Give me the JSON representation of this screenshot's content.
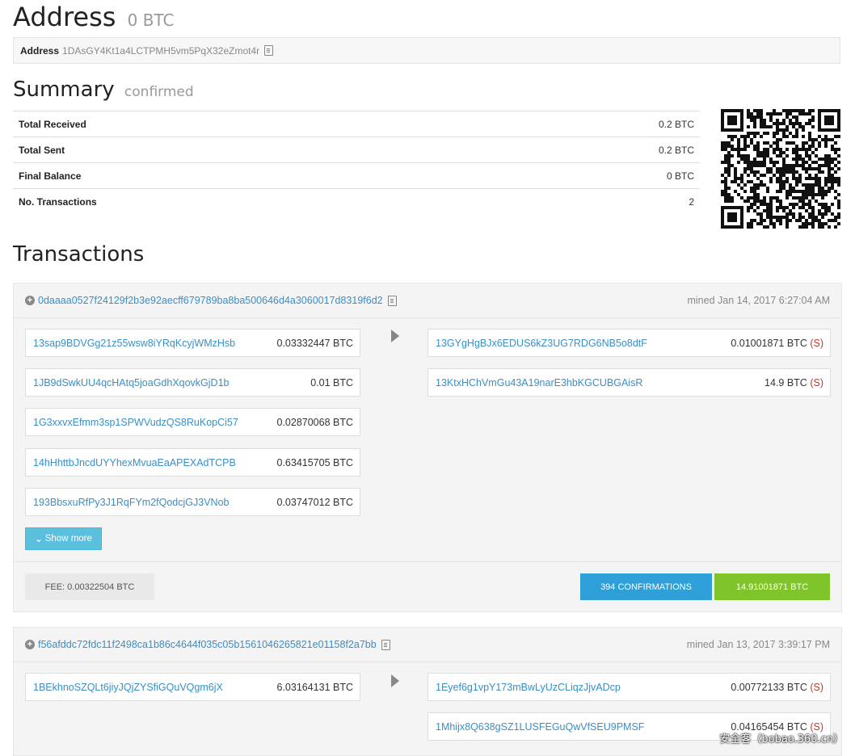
{
  "header": {
    "title": "Address",
    "balance": "0 BTC"
  },
  "address_box": {
    "label": "Address",
    "value": "1DAsGY4Kt1a4LCTPMH5vm5PqX32eZmot4r",
    "copy_icon": "copy-icon"
  },
  "summary": {
    "title": "Summary",
    "status": "confirmed",
    "rows": [
      {
        "key": "Total Received",
        "value": "0.2 BTC"
      },
      {
        "key": "Total Sent",
        "value": "0.2 BTC"
      },
      {
        "key": "Final Balance",
        "value": "0 BTC"
      },
      {
        "key": "No. Transactions",
        "value": "2"
      }
    ]
  },
  "qr_code": "qr-code-image",
  "transactions_title": "Transactions",
  "transactions": [
    {
      "hash": "0daaaa0527f24129f2b3e92aecff679789ba8ba500646d4a3060017d8319f6d2",
      "time": "mined Jan 14, 2017 6:27:04 AM",
      "inputs": [
        {
          "address": "13sap9BDVGg21z55wsw8iYRqKcyjWMzHsb",
          "amount": "0.03332447 BTC"
        },
        {
          "address": "1JB9dSwkUU4qcHAtq5joaGdhXqovkGjD1b",
          "amount": "0.01 BTC"
        },
        {
          "address": "1G3xxvxEfmm3sp1SPWVudzQS8RuKopCi57",
          "amount": "0.02870068 BTC"
        },
        {
          "address": "14hHhttbJncdUYYhexMvuaEaAPEXAdTCPB",
          "amount": "0.63415705 BTC"
        },
        {
          "address": "193BbsxuRfPy3J1RqFYm2fQodcjGJ3VNob",
          "amount": "0.03747012 BTC"
        }
      ],
      "outputs": [
        {
          "address": "13GYgHgBJx6EDUS6kZ3UG7RDG6NB5o8dtF",
          "amount": "0.01001871 BTC",
          "spent": "(S)"
        },
        {
          "address": "13KtxHChVmGu43A19narE3hbKGCUBGAisR",
          "amount": "14.9 BTC",
          "spent": "(S)"
        }
      ],
      "show_more": "Show more",
      "fee": "FEE: 0.00322504 BTC",
      "confirmations": "394 CONFIRMATIONS",
      "total": "14.91001871 BTC"
    },
    {
      "hash": "f56afddc72fdc11f2498ca1b86c4644f035c05b1561046265821e01158f2a7bb",
      "time": "mined Jan 13, 2017 3:39:17 PM",
      "inputs": [
        {
          "address": "1BEkhnoSZQLt6jiyJQjZYSfiGQuVQgm6jX",
          "amount": "6.03164131 BTC"
        }
      ],
      "outputs": [
        {
          "address": "1Eyef6g1vpY173mBwLyUzCLiqzJjvADcp",
          "amount": "0.00772133 BTC",
          "spent": "(S)"
        },
        {
          "address": "1Mhijx8Q638gSZ1LUSFEGuQwVfSEU9PMSF",
          "amount": "0.04165454 BTC",
          "spent": "(S)"
        }
      ]
    }
  ],
  "watermark": "安全客（bobao.360.cn）",
  "colors": {
    "link": "#3a8fc5",
    "confirmations": "#2f9fd8",
    "total": "#7fc42a",
    "show_more": "#5bc0de",
    "spent": "#c0392b"
  }
}
